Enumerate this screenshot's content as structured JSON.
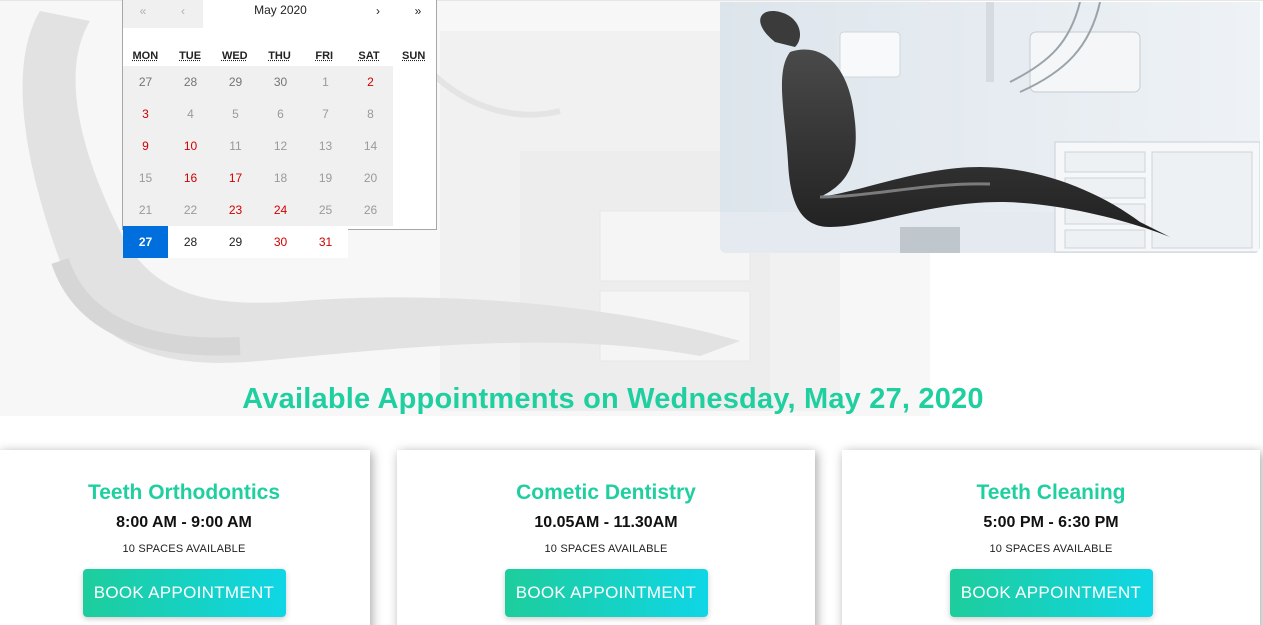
{
  "calendar": {
    "prev_year": "«",
    "prev_month": "‹",
    "month_label": "May 2020",
    "next_month": "›",
    "next_year": "»",
    "weekdays": [
      "MON",
      "TUE",
      "WED",
      "THU",
      "FRI",
      "SAT",
      "SUN"
    ],
    "days": [
      {
        "label": "27",
        "kind": "prev-month"
      },
      {
        "label": "28",
        "kind": "prev-month"
      },
      {
        "label": "29",
        "kind": "prev-month"
      },
      {
        "label": "30",
        "kind": "prev-month"
      },
      {
        "label": "1",
        "kind": "past"
      },
      {
        "label": "2",
        "kind": "past-weekend"
      },
      {
        "label": "3",
        "kind": "past-weekend"
      },
      {
        "label": "4",
        "kind": "past"
      },
      {
        "label": "5",
        "kind": "past"
      },
      {
        "label": "6",
        "kind": "past"
      },
      {
        "label": "7",
        "kind": "past"
      },
      {
        "label": "8",
        "kind": "past"
      },
      {
        "label": "9",
        "kind": "past-weekend"
      },
      {
        "label": "10",
        "kind": "past-weekend"
      },
      {
        "label": "11",
        "kind": "past"
      },
      {
        "label": "12",
        "kind": "past"
      },
      {
        "label": "13",
        "kind": "past"
      },
      {
        "label": "14",
        "kind": "past"
      },
      {
        "label": "15",
        "kind": "past"
      },
      {
        "label": "16",
        "kind": "past-weekend"
      },
      {
        "label": "17",
        "kind": "past-weekend"
      },
      {
        "label": "18",
        "kind": "past"
      },
      {
        "label": "19",
        "kind": "past"
      },
      {
        "label": "20",
        "kind": "past"
      },
      {
        "label": "21",
        "kind": "past"
      },
      {
        "label": "22",
        "kind": "past"
      },
      {
        "label": "23",
        "kind": "past-weekend"
      },
      {
        "label": "24",
        "kind": "past-weekend"
      },
      {
        "label": "25",
        "kind": "past"
      },
      {
        "label": "26",
        "kind": "past"
      },
      {
        "label": "27",
        "kind": "selected"
      },
      {
        "label": "28",
        "kind": "active"
      },
      {
        "label": "29",
        "kind": "active"
      },
      {
        "label": "30",
        "kind": "active-weekend"
      },
      {
        "label": "31",
        "kind": "active-weekend"
      }
    ],
    "colors": {
      "selected": "#006edc",
      "weekend": "#d10000"
    }
  },
  "heading": "Available Appointments on Wednesday, May 27, 2020",
  "appointments": [
    {
      "service": "Teeth Orthodontics",
      "time": "8:00 AM - 9:00 AM",
      "spaces": "10 SPACES AVAILABLE",
      "button": "BOOK APPOINTMENT"
    },
    {
      "service": "Cometic Dentistry",
      "time": "10.05AM - 11.30AM",
      "spaces": "10 SPACES AVAILABLE",
      "button": "BOOK APPOINTMENT"
    },
    {
      "service": "Teeth Cleaning",
      "time": "5:00 PM - 6:30 PM",
      "spaces": "10 SPACES AVAILABLE",
      "button": "BOOK APPOINTMENT"
    }
  ],
  "colors": {
    "accent": "#1fcfa0",
    "button_gradient_start": "#1ecd9c",
    "button_gradient_end": "#0fd6e6"
  },
  "icons": {
    "photo": "dental-chair-photo"
  }
}
